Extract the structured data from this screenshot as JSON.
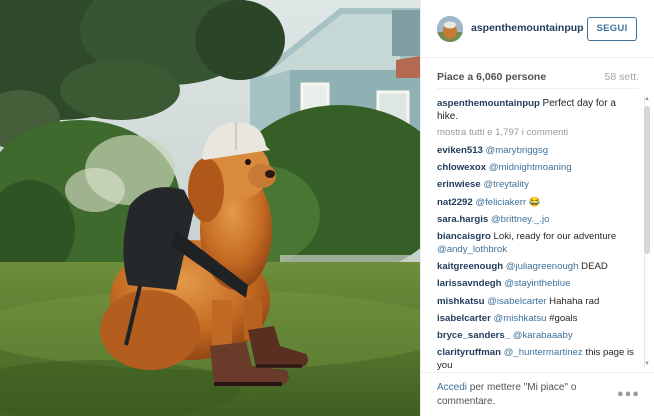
{
  "post": {
    "username": "aspenthemountainpup",
    "follow_label": "SEGUI",
    "likes": "Piace a 6,060 persone",
    "age": "58 sett.",
    "caption": {
      "user": "aspenthemountainpup",
      "text": "Perfect day for a hike."
    },
    "show_all": "mostra tutti e 1,797 i commenti",
    "comments": [
      {
        "user": "eviken513",
        "mention": "@marybriggsg",
        "text": ""
      },
      {
        "user": "chlowexox",
        "mention": "@midnightmoaning",
        "text": ""
      },
      {
        "user": "erinwiese",
        "mention": "@treytality",
        "text": ""
      },
      {
        "user": "nat2292",
        "mention": "@feliciakerr",
        "text": "😂"
      },
      {
        "user": "sara.hargis",
        "mention": "@brittney._.jo",
        "text": ""
      },
      {
        "user": "biancaisgro",
        "text_before": "Loki, ready for our adventure",
        "mention": "@andy_lothbrok",
        "text": ""
      },
      {
        "user": "kaitgreenough",
        "mention": "@juliagreenough",
        "text": "DEAD"
      },
      {
        "user": "larissavndegh",
        "mention": "@stayintheblue",
        "text": ""
      },
      {
        "user": "mishkatsu",
        "mention": "@isabelcarter",
        "text": "Hahaha rad"
      },
      {
        "user": "isabelcarter",
        "mention": "@mishkatsu",
        "text": "#goals"
      },
      {
        "user": "bryce_sanders_",
        "mention": "@karabaaaby",
        "text": ""
      },
      {
        "user": "clarityruffman",
        "mention": "@_huntermartinez",
        "text": "this page is you"
      }
    ],
    "footer": {
      "login_link": "Accedi",
      "login_text": "per mettere \"Mi piace\" o commentare."
    },
    "more_icon": "more-options-icon"
  },
  "colors": {
    "accent": "#3f729b",
    "username": "#1f3b5a",
    "muted": "#999999"
  }
}
